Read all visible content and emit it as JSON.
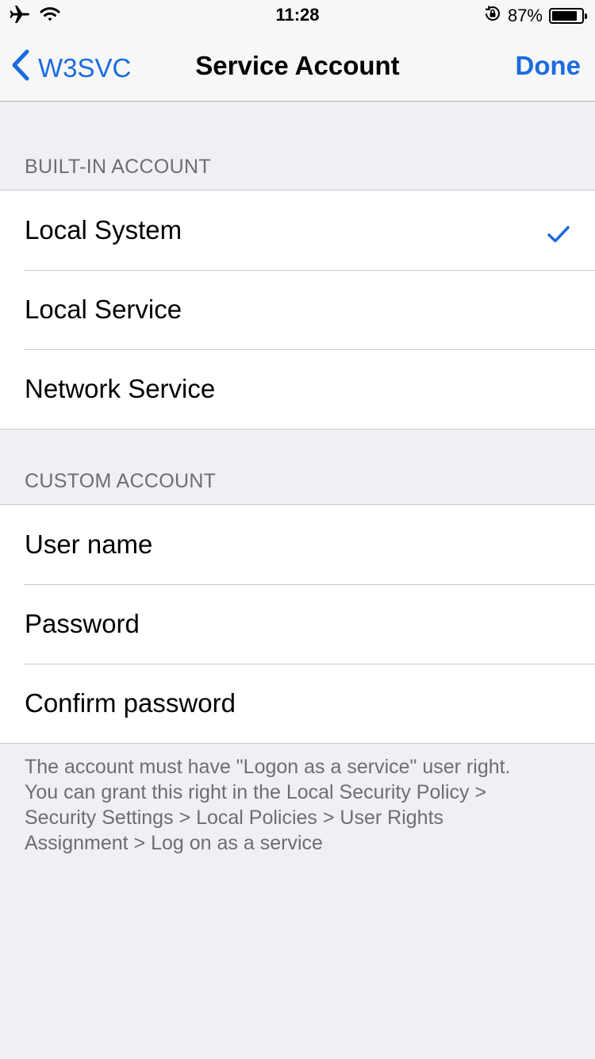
{
  "status_bar": {
    "time": "11:28",
    "battery_text": "87%",
    "battery_level": 0.87,
    "icons": [
      "airplane-icon",
      "wifi-icon",
      "rotation-lock-icon",
      "battery-icon"
    ]
  },
  "nav": {
    "back_label": "W3SVC",
    "title": "Service Account",
    "done_label": "Done",
    "accent_color": "#1b6be0"
  },
  "builtin": {
    "header": "BUILT-IN ACCOUNT",
    "items": [
      {
        "label": "Local System",
        "selected": true
      },
      {
        "label": "Local Service",
        "selected": false
      },
      {
        "label": "Network Service",
        "selected": false
      }
    ]
  },
  "custom": {
    "header": "CUSTOM ACCOUNT",
    "fields": [
      {
        "label": "User name"
      },
      {
        "label": "Password"
      },
      {
        "label": "Confirm password"
      }
    ]
  },
  "footer": {
    "line1": "The account must have \"Logon as a service\" user right.",
    "line2": "You can grant this right in the Local Security Policy >",
    "line3": "Security Settings > Local Policies > User Rights",
    "line4": "Assignment > Log on as a service"
  }
}
